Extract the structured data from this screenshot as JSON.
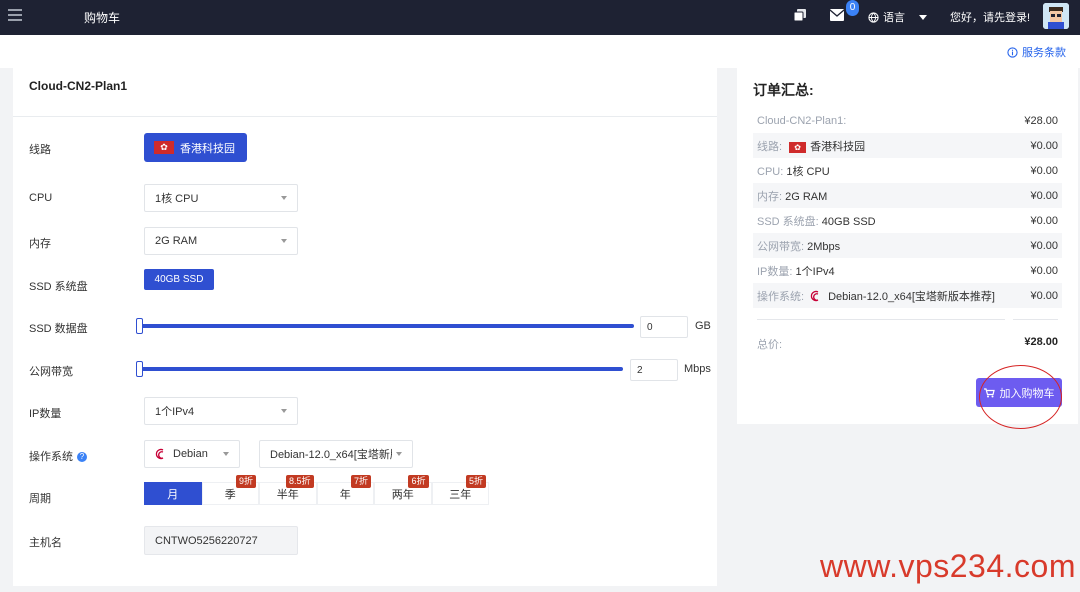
{
  "header": {
    "title": "购物车",
    "mail_count": "0",
    "language_label": "语言",
    "greeting": "您好，请先登录!"
  },
  "strip": {
    "tos_label": "服务条款"
  },
  "product": {
    "name": "Cloud-CN2-Plan1",
    "fields": {
      "route_label": "线路",
      "route_value": "香港科技园",
      "cpu_label": "CPU",
      "cpu_value": "1核 CPU",
      "ram_label": "内存",
      "ram_value": "2G RAM",
      "ssd_sys_label": "SSD 系统盘",
      "ssd_sys_value": "40GB SSD",
      "ssd_data_label": "SSD 数据盘",
      "ssd_data_value": "0",
      "ssd_data_unit": "GB",
      "bandwidth_label": "公网带宽",
      "bandwidth_value": "2",
      "bandwidth_unit": "Mbps",
      "ip_label": "IP数量",
      "ip_value": "1个IPv4",
      "os_label": "操作系统",
      "os_family": "Debian",
      "os_version": "Debian-12.0_x64[宝塔新版",
      "period_label": "周期",
      "hostname_label": "主机名",
      "hostname_value": "CNTWO5256220727"
    },
    "periods": [
      {
        "label": "月",
        "discount": ""
      },
      {
        "label": "季",
        "discount": "9折"
      },
      {
        "label": "半年",
        "discount": "8.5折"
      },
      {
        "label": "年",
        "discount": "7折"
      },
      {
        "label": "两年",
        "discount": "6折"
      },
      {
        "label": "三年",
        "discount": "5折"
      }
    ]
  },
  "summary": {
    "title": "订单汇总:",
    "rows": [
      {
        "key": "Cloud-CN2-Plan1:",
        "value": "",
        "price": "¥28.00"
      },
      {
        "key": "线路:",
        "value": "香港科技园",
        "price": "¥0.00"
      },
      {
        "key": "CPU:",
        "value": "1核 CPU",
        "price": "¥0.00"
      },
      {
        "key": "内存:",
        "value": "2G RAM",
        "price": "¥0.00"
      },
      {
        "key": "SSD 系统盘:",
        "value": "40GB SSD",
        "price": "¥0.00"
      },
      {
        "key": "公网带宽:",
        "value": "2Mbps",
        "price": "¥0.00"
      },
      {
        "key": "IP数量:",
        "value": "1个IPv4",
        "price": "¥0.00"
      },
      {
        "key": "操作系统:",
        "value": "Debian-12.0_x64[宝塔新版本推荐]",
        "price": "¥0.00"
      }
    ],
    "total_label": "总价:",
    "total_value": "¥28.00",
    "cart_button": "加入购物车"
  },
  "watermark": "www.vps234.com",
  "colors": {
    "accent": "#2f4fd1",
    "cart": "#6d5cf0",
    "discount": "#c23a22",
    "topbar": "#1e2233"
  }
}
